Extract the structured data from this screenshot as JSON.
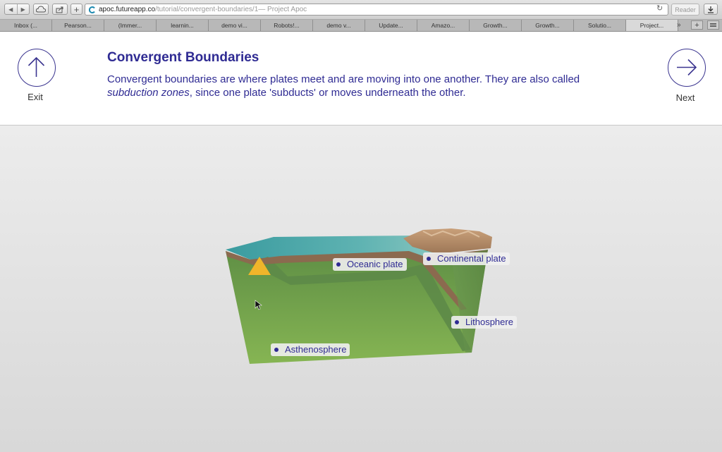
{
  "browser": {
    "url_host": "apoc.futureapp.co",
    "url_path": "/tutorial/convergent-boundaries/1",
    "page_title": " — Project Apoc",
    "reader_label": "Reader",
    "tabs": [
      "Inbox (...",
      "Pearson...",
      "(Immer...",
      "learnin...",
      "demo vi...",
      "Robots!...",
      "demo v...",
      "Update...",
      "Amazo...",
      "Growth...",
      "Growth...",
      "Solutio...",
      "Project..."
    ]
  },
  "header": {
    "title": "Convergent Boundaries",
    "desc_part1": "Convergent boundaries are where plates meet and are moving into one another. They are also called ",
    "desc_em": "subduction zones",
    "desc_part2": ", since one plate 'subducts' or moves underneath the other.",
    "exit_label": "Exit",
    "next_label": "Next"
  },
  "labels": {
    "oceanic": "Oceanic plate",
    "continental": "Continental plate",
    "lithosphere": "Lithosphere",
    "asthenosphere": "Asthenosphere"
  },
  "colors": {
    "accent": "#2f2b93",
    "ocean": "#3fa0a2",
    "mantle": "#6fa34a"
  }
}
